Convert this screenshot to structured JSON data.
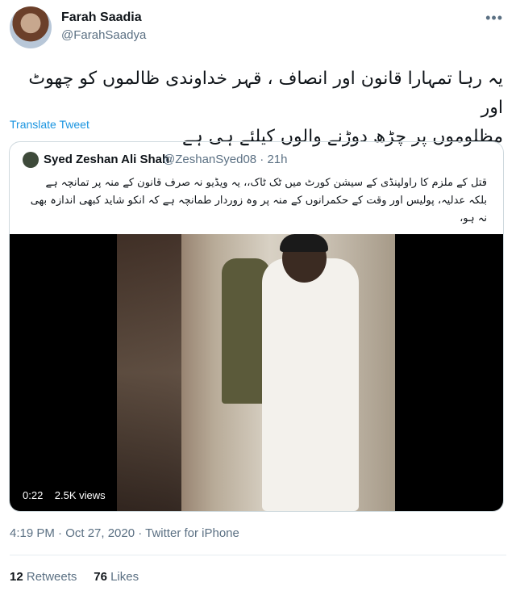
{
  "author": {
    "name": "Farah Saadia",
    "handle": "@FarahSaadya"
  },
  "tweet": {
    "line1": "یہ رہا تمہارا قانون اور انصاف ، قہر خداوندی ظالموں کو چھوٹ اور",
    "line2": "مظلوموں پر چڑھ دوڑنے والوں کیلئے ہی ہے",
    "translate": "Translate Tweet"
  },
  "quoted": {
    "name": "Syed Zeshan Ali Shah",
    "handle": "@ZeshanSyed08 · 21h",
    "line1": "قتل کے ملزم کا راولپنڈی کے سیشن کورٹ میں ٹک ٹاک،، یہ ویڈیو نہ صرف قانون کے منہ پر تمانچہ ہے",
    "line2": "بلکہ عدلیہ، پولیس اور وقت کے حکمرانوں کے منہ پر وہ زوردار طمانچہ ہے کہ انکو شاید کبھی اندازہ بھی",
    "line3": "نہ ہو،",
    "video": {
      "duration": "0:22",
      "views": "2.5K views"
    }
  },
  "meta": {
    "timestamp": "4:19 PM · Oct 27, 2020 · Twitter for iPhone"
  },
  "stats": {
    "retweets_count": "12",
    "retweets_label": "Retweets",
    "likes_count": "76",
    "likes_label": "Likes"
  },
  "icons": {
    "more": "more-horizontal-icon"
  }
}
